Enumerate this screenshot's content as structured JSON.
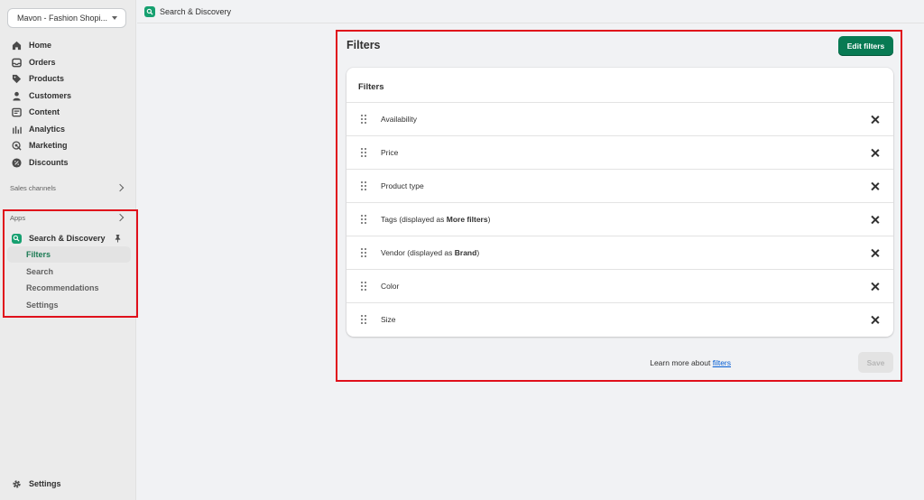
{
  "store": {
    "name": "Mavon - Fashion Shopi..."
  },
  "nav": {
    "items": [
      {
        "label": "Home",
        "icon": "home-icon"
      },
      {
        "label": "Orders",
        "icon": "orders-icon"
      },
      {
        "label": "Products",
        "icon": "tag-icon"
      },
      {
        "label": "Customers",
        "icon": "person-icon"
      },
      {
        "label": "Content",
        "icon": "content-icon"
      },
      {
        "label": "Analytics",
        "icon": "analytics-icon"
      },
      {
        "label": "Marketing",
        "icon": "marketing-icon"
      },
      {
        "label": "Discounts",
        "icon": "discount-icon"
      }
    ],
    "sales_channels_label": "Sales channels",
    "apps_label": "Apps",
    "app": {
      "name": "Search & Discovery",
      "subitems": [
        "Filters",
        "Search",
        "Recommendations",
        "Settings"
      ]
    },
    "settings_label": "Settings"
  },
  "topbar": {
    "title": "Search & Discovery"
  },
  "page": {
    "title": "Filters",
    "edit_button": "Edit filters",
    "card_title": "Filters",
    "filters": [
      {
        "label": "Availability"
      },
      {
        "label": "Price"
      },
      {
        "label": "Product type"
      },
      {
        "label": "Tags (displayed as ",
        "bold": "More filters",
        "suffix": ")"
      },
      {
        "label": "Vendor (displayed as ",
        "bold": "Brand",
        "suffix": ")"
      },
      {
        "label": "Color"
      },
      {
        "label": "Size"
      }
    ],
    "learn_more_prefix": "Learn more about ",
    "learn_more_link": "filters",
    "save_button": "Save"
  },
  "colors": {
    "primary_button": "#087a53",
    "active_nav": "#1a7a53",
    "app_badge": "#16a070",
    "highlight": "#e0101b",
    "link": "#005bd3"
  }
}
